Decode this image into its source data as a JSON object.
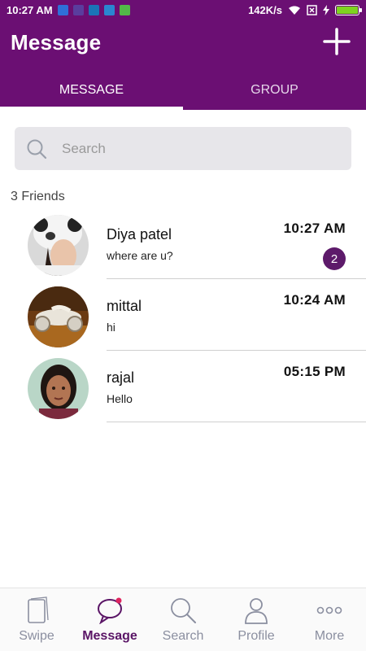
{
  "status_bar": {
    "time": "10:27 AM",
    "network_speed": "142K/s",
    "battery_color": "#7ed321"
  },
  "header": {
    "title": "Message",
    "add_icon": "plus-icon",
    "bg_color": "#6b0f73"
  },
  "tabs": [
    {
      "label": "MESSAGE",
      "active": true
    },
    {
      "label": "GROUP",
      "active": false
    }
  ],
  "search": {
    "placeholder": "Search",
    "value": ""
  },
  "friends_count": "3 Friends",
  "conversations": [
    {
      "name": "Diya patel",
      "preview": "where are u?",
      "time": "10:27 AM",
      "unread": "2"
    },
    {
      "name": "mittal",
      "preview": "hi",
      "time": "10:24 AM",
      "unread": ""
    },
    {
      "name": "rajal",
      "preview": "Hello",
      "time": "05:15 PM",
      "unread": ""
    }
  ],
  "bottom_nav": [
    {
      "label": "Swipe",
      "icon": "cards-icon",
      "active": false
    },
    {
      "label": "Message",
      "icon": "chat-bubble-icon",
      "active": true
    },
    {
      "label": "Search",
      "icon": "search-icon",
      "active": false
    },
    {
      "label": "Profile",
      "icon": "person-icon",
      "active": false
    },
    {
      "label": "More",
      "icon": "more-dots-icon",
      "active": false
    }
  ]
}
